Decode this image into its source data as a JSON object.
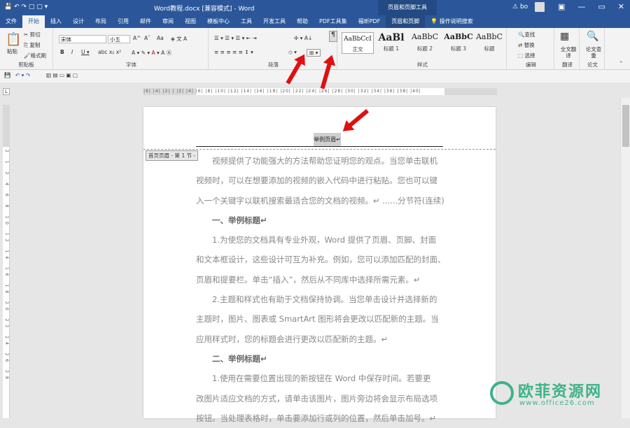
{
  "window": {
    "doc_title": "Word教程.docx [兼容模式] - Word",
    "context_title": "页眉和页脚工具",
    "user": "bo",
    "btn_min": "—",
    "btn_restore": "▭",
    "btn_close": "✕"
  },
  "tabs": [
    "文件",
    "开始",
    "插入",
    "设计",
    "布局",
    "引用",
    "邮件",
    "审阅",
    "视图",
    "模板中心",
    "工具",
    "开发工具",
    "帮助",
    "PDF工具集",
    "福昕PDF",
    "页眉和页脚",
    "操作说明搜索"
  ],
  "ribbon": {
    "clipboard": {
      "paste": "粘贴",
      "cut": "剪切",
      "copy": "复制",
      "format_painter": "格式刷",
      "label": "剪贴板"
    },
    "font": {
      "name": "宋体",
      "size": "小五",
      "grow": "A^",
      "shrink": "Aˇ",
      "case": "Aa",
      "label": "字体"
    },
    "paragraph": {
      "label": "段落"
    },
    "styles": {
      "items": [
        {
          "preview": "AaBbCcI",
          "name": "正文"
        },
        {
          "preview": "AaBl",
          "name": "标题 1"
        },
        {
          "preview": "AaBbC",
          "name": "标题 2"
        },
        {
          "preview": "AaBbC",
          "name": "标题 3"
        },
        {
          "preview": "AaBbC",
          "name": "标题"
        }
      ],
      "label": "样式"
    },
    "editing": {
      "find": "查找",
      "replace": "替换",
      "select": "选择",
      "label": "编辑"
    },
    "translate": {
      "btn": "全文翻译",
      "label": "翻译"
    },
    "paper": {
      "btn": "论文查重",
      "label": "论文"
    }
  },
  "ruler": {
    "h_ticks": "|6| |4| |2| |  |2| |4| |6| |8| |10| |12| |14| |16| |18| |20| |22| |24| |26| |28| |30| |32| |34| |36| |38| |40|",
    "v_ticks": "2 1 2 4 6 8 10 12 14 16 18 20 22 24 26 28"
  },
  "document": {
    "header_text": "举例页眉",
    "header_mark": "↵",
    "header_label": "首页页眉 - 第 1 节 -",
    "paragraphs": [
      {
        "text": "视频提供了功能强大的方法帮助您证明您的观点。当您单击联机",
        "indent": true
      },
      {
        "text": "视频时，可以在想要添加的视频的嵌入代码中进行粘贴。您也可以键",
        "indent": false
      },
      {
        "text": "入一个关键字以联机搜索最适合您的文档的视频。↵ ......分节符(连续)......",
        "indent": false
      },
      {
        "text": "一、举例标题↵",
        "indent": true,
        "heading": true
      },
      {
        "text": "1.为使您的文档具有专业外观，Word 提供了页眉、页脚、封面",
        "indent": true
      },
      {
        "text": "和文本框设计，这些设计可互为补充。例如，您可以添加匹配的封面、",
        "indent": false
      },
      {
        "text": "页眉和提要栏。单击“插入”，然后从不同库中选择所需元素。↵",
        "indent": false
      },
      {
        "text": "2.主题和样式也有助于文档保持协调。当您单击设计并选择新的",
        "indent": true
      },
      {
        "text": "主题时，图片、图表或 SmartArt 图形将会更改以匹配新的主题。当",
        "indent": false
      },
      {
        "text": "应用样式时，您的标题会进行更改以匹配新的主题。↵",
        "indent": false
      },
      {
        "text": "二、举例标题↵",
        "indent": true,
        "heading": true
      },
      {
        "text": "1.使用在需要位置出现的新按钮在 Word 中保存时间。若要更",
        "indent": true
      },
      {
        "text": "改图片适应文档的方式，请单击该图片，图片旁边将会显示布局选项",
        "indent": false
      },
      {
        "text": "按钮。当处理表格时，单击要添加行或列的位置，然后单击加号。↵",
        "indent": false
      }
    ]
  },
  "watermark": {
    "name": "欧菲资源网",
    "url": "www.office26.com"
  },
  "colors": {
    "accent": "#2b579a",
    "arrow": "#e01010",
    "logo": "#3db388"
  }
}
